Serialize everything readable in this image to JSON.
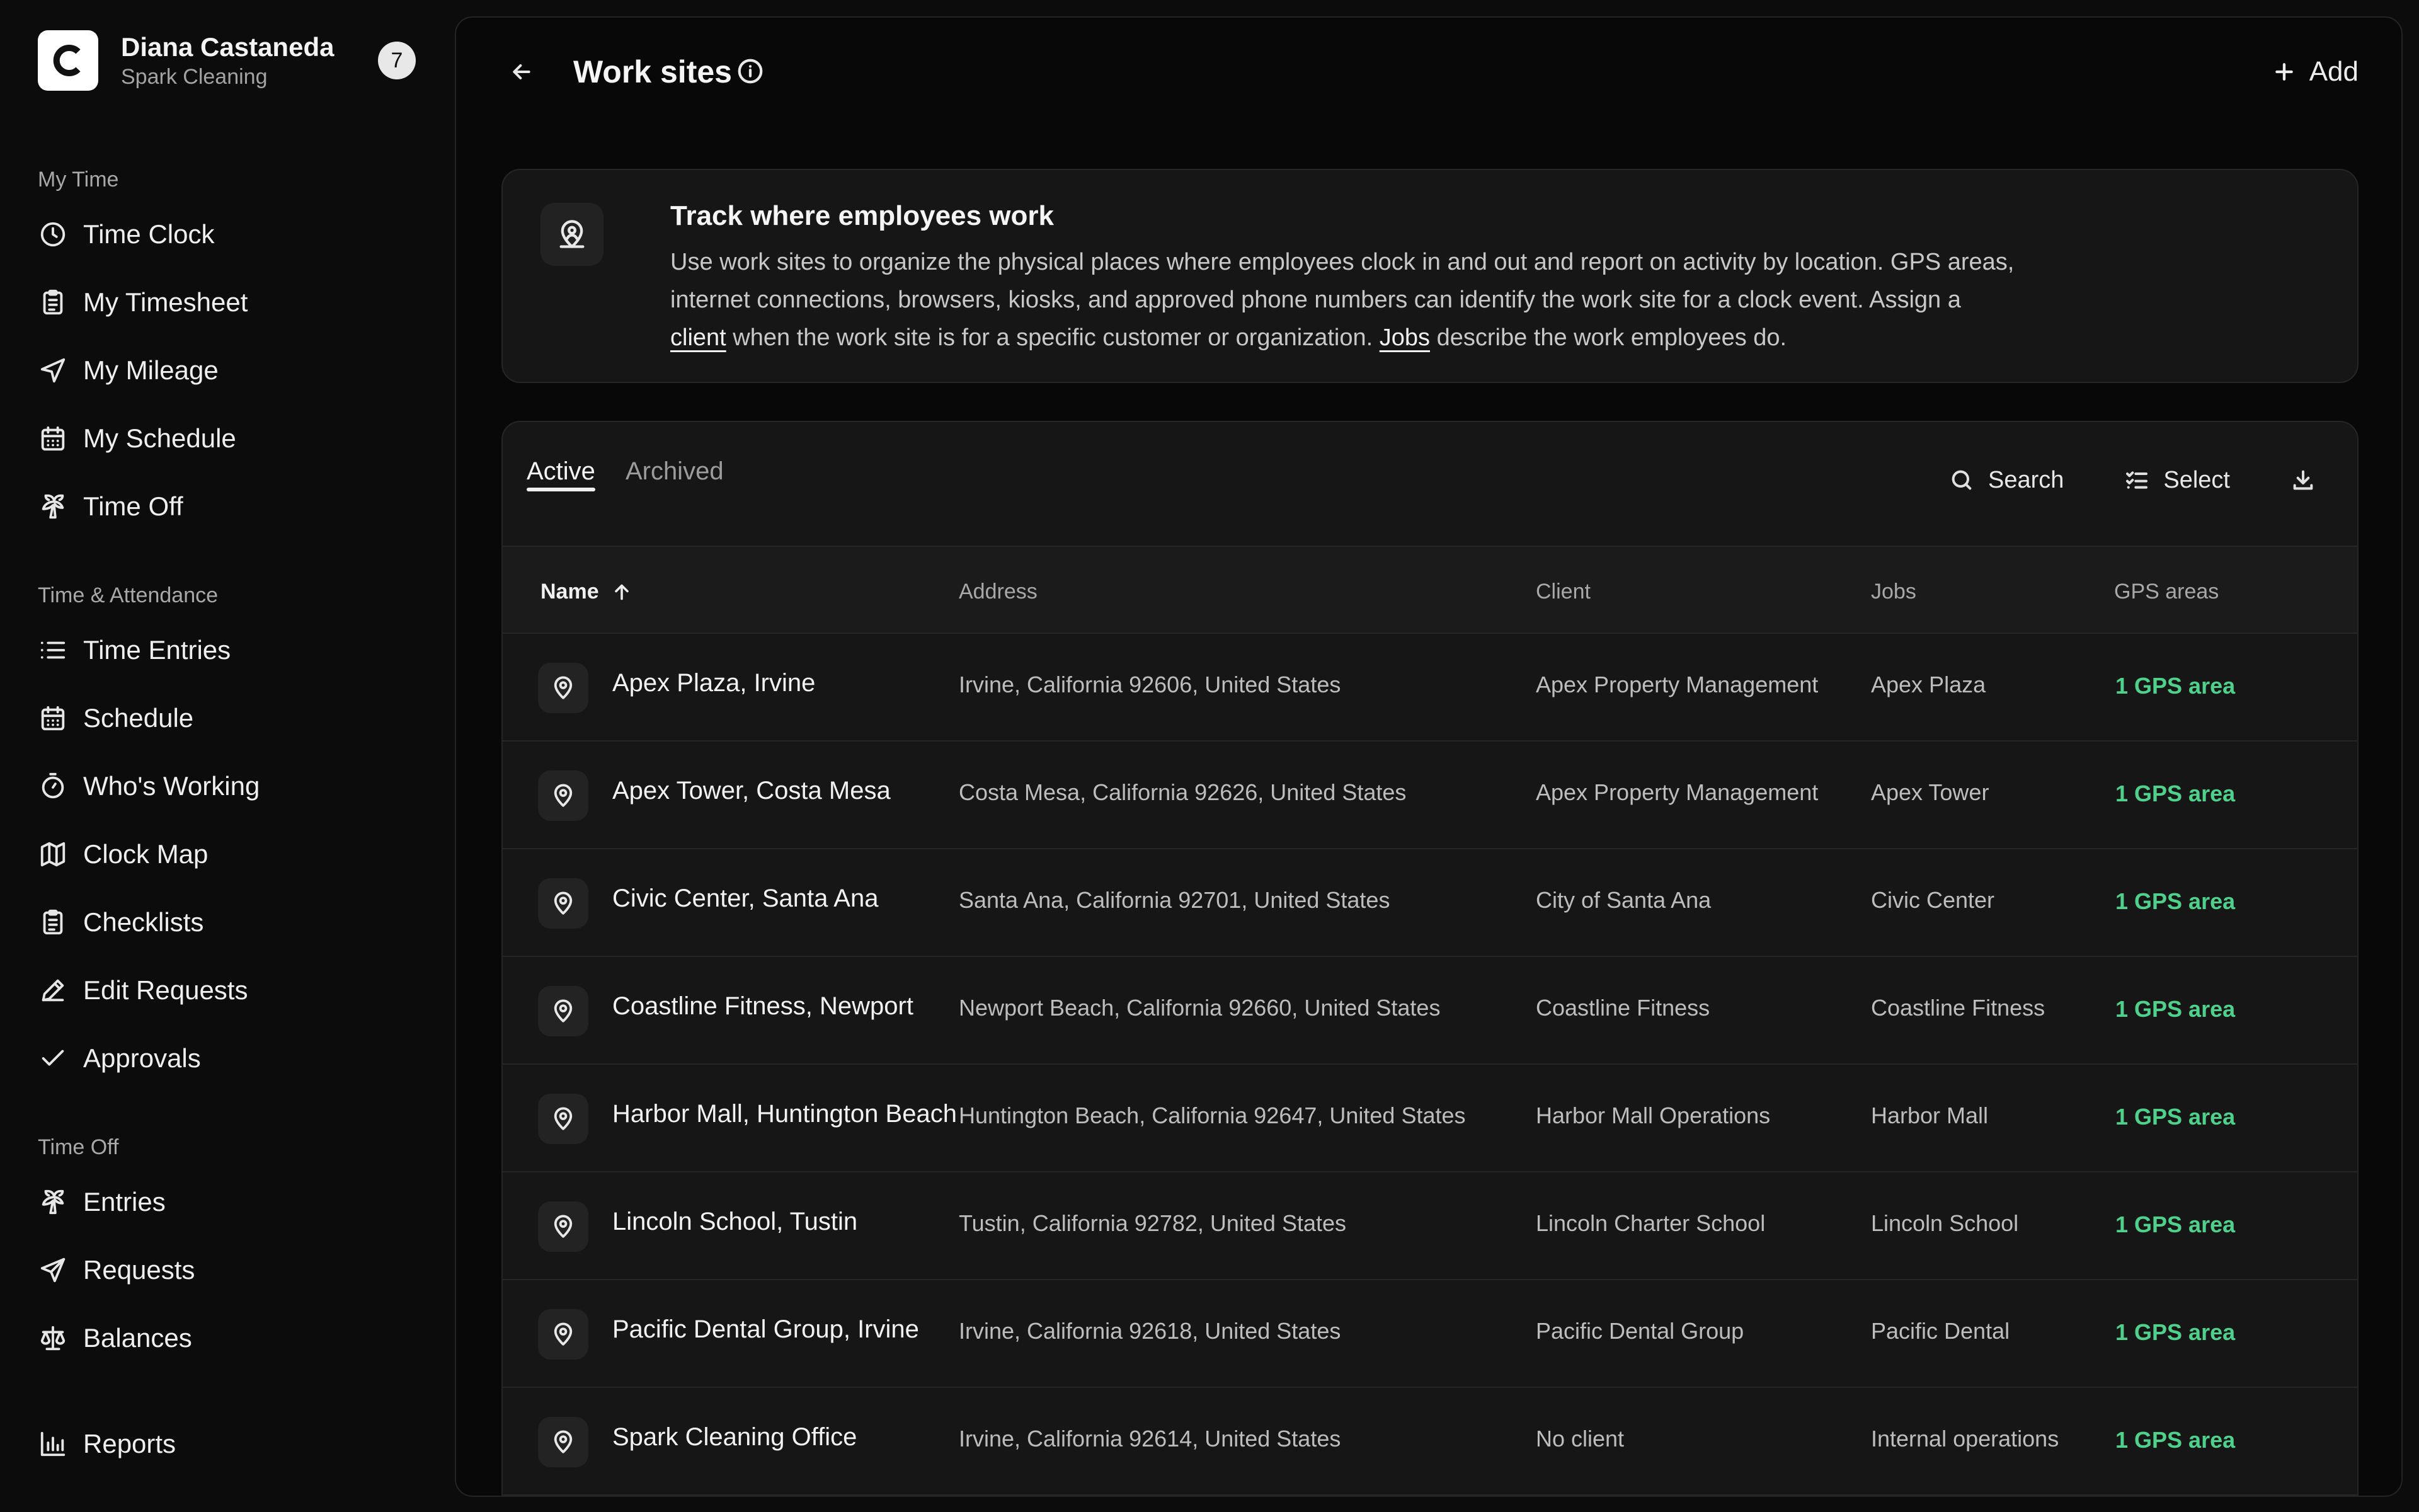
{
  "profile": {
    "name": "Diana Castaneda",
    "org": "Spark Cleaning",
    "badge": "7"
  },
  "sidebar": {
    "sections": [
      {
        "label": "My Time"
      },
      {
        "label": "Time & Attendance"
      },
      {
        "label": "Time Off"
      }
    ],
    "my_time": [
      {
        "label": "Time Clock",
        "icon": "clock-icon"
      },
      {
        "label": "My Timesheet",
        "icon": "clipboard-icon"
      },
      {
        "label": "My Mileage",
        "icon": "navigation-icon"
      },
      {
        "label": "My Schedule",
        "icon": "calendar-icon"
      },
      {
        "label": "Time Off",
        "icon": "palm-tree-icon"
      }
    ],
    "attendance": [
      {
        "label": "Time Entries",
        "icon": "list-icon"
      },
      {
        "label": "Schedule",
        "icon": "calendar-icon"
      },
      {
        "label": "Who's Working",
        "icon": "stopwatch-icon"
      },
      {
        "label": "Clock Map",
        "icon": "map-icon"
      },
      {
        "label": "Checklists",
        "icon": "clipboard-check-icon"
      },
      {
        "label": "Edit Requests",
        "icon": "pencil-icon"
      },
      {
        "label": "Approvals",
        "icon": "check-icon"
      }
    ],
    "time_off": [
      {
        "label": "Entries",
        "icon": "palm-tree-icon"
      },
      {
        "label": "Requests",
        "icon": "send-icon"
      },
      {
        "label": "Balances",
        "icon": "scale-icon"
      }
    ],
    "reports": {
      "label": "Reports",
      "icon": "bar-chart-icon"
    }
  },
  "header": {
    "title": "Work sites",
    "add_label": "Add"
  },
  "callout": {
    "title": "Track where employees work",
    "line1": "Use work sites to organize the physical places where employees clock in and out and report on activity by location. GPS areas,",
    "line2": "internet connections, browsers, kiosks, and approved phone numbers can identify the work site for a clock event. Assign a",
    "client_link": "client",
    "mid": " when the work site is for a specific customer or organization. ",
    "jobs_link": "Jobs",
    "end": " describe the work employees do."
  },
  "tabs": [
    {
      "label": "Active",
      "active": true
    },
    {
      "label": "Archived",
      "active": false
    }
  ],
  "toolbar": {
    "search": "Search",
    "select": "Select"
  },
  "table": {
    "headers": {
      "name": "Name",
      "address": "Address",
      "client": "Client",
      "jobs": "Jobs",
      "gps": "GPS areas"
    },
    "rows": [
      {
        "name": "Apex Plaza, Irvine",
        "address": "Irvine, California 92606, United States",
        "client": "Apex Property Management",
        "jobs": "Apex Plaza",
        "gps": "1 GPS area"
      },
      {
        "name": "Apex Tower, Costa Mesa",
        "address": "Costa Mesa, California 92626, United States",
        "client": "Apex Property Management",
        "jobs": "Apex Tower",
        "gps": "1 GPS area"
      },
      {
        "name": "Civic Center, Santa Ana",
        "address": "Santa Ana, California 92701, United States",
        "client": "City of Santa Ana",
        "jobs": "Civic Center",
        "gps": "1 GPS area"
      },
      {
        "name": "Coastline Fitness, Newport",
        "address": "Newport Beach, California 92660, United States",
        "client": "Coastline Fitness",
        "jobs": "Coastline Fitness",
        "gps": "1 GPS area"
      },
      {
        "name": "Harbor Mall, Huntington Beach",
        "address": "Huntington Beach, California 92647, United States",
        "client": "Harbor Mall Operations",
        "jobs": "Harbor Mall",
        "gps": "1 GPS area"
      },
      {
        "name": "Lincoln School, Tustin",
        "address": "Tustin, California 92782, United States",
        "client": "Lincoln Charter School",
        "jobs": "Lincoln School",
        "gps": "1 GPS area"
      },
      {
        "name": "Pacific Dental Group, Irvine",
        "address": "Irvine, California 92618, United States",
        "client": "Pacific Dental Group",
        "jobs": "Pacific Dental",
        "gps": "1 GPS area"
      },
      {
        "name": "Spark Cleaning Office",
        "address": "Irvine, California 92614, United States",
        "client": "No client",
        "jobs": "Internal operations",
        "gps": "1 GPS area"
      }
    ]
  },
  "colors": {
    "background": "#0c0c0c",
    "panel": "#161616",
    "accent_green": "#4fd18c"
  }
}
